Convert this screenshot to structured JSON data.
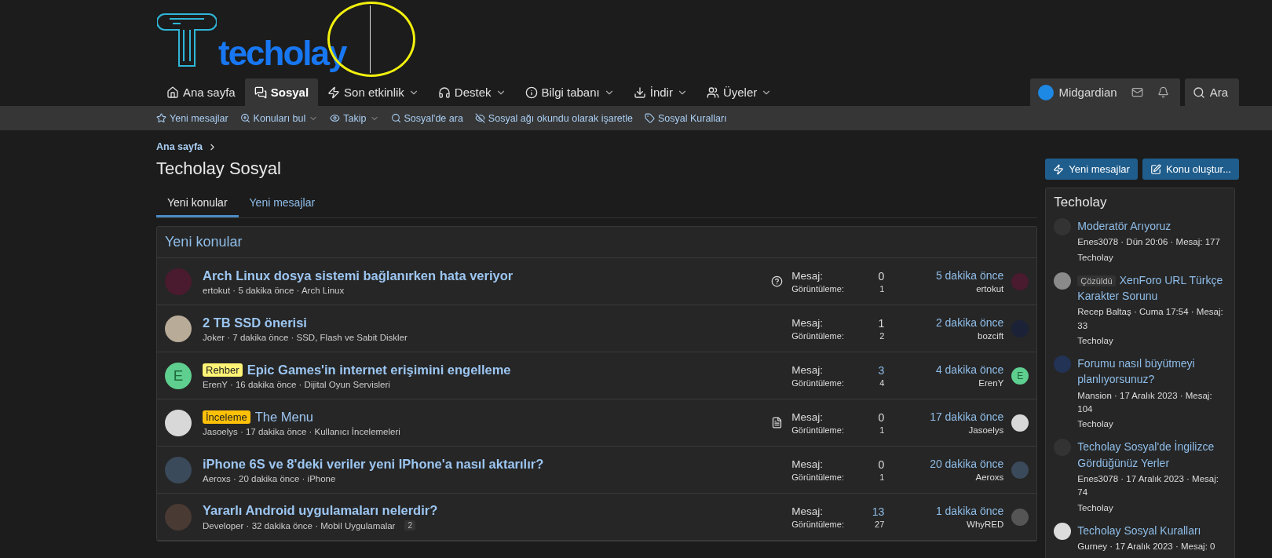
{
  "logo": {
    "text": "techolay"
  },
  "annotation": {
    "kind": "circle"
  },
  "nav": {
    "tabs": [
      {
        "label": "Ana sayfa",
        "selected": false,
        "dropdown": false
      },
      {
        "label": "Sosyal",
        "selected": true,
        "dropdown": false
      },
      {
        "label": "Son etkinlik",
        "selected": false,
        "dropdown": true
      },
      {
        "label": "Destek",
        "selected": false,
        "dropdown": true
      },
      {
        "label": "Bilgi tabanı",
        "selected": false,
        "dropdown": true
      },
      {
        "label": "İndir",
        "selected": false,
        "dropdown": true
      },
      {
        "label": "Üyeler",
        "selected": false,
        "dropdown": true
      }
    ],
    "user": {
      "name": "Midgardian"
    },
    "search": {
      "label": "Ara"
    }
  },
  "subnav": [
    {
      "label": "Yeni mesajlar",
      "dropdown": false
    },
    {
      "label": "Konuları bul",
      "dropdown": true
    },
    {
      "label": "Takip",
      "dropdown": true
    },
    {
      "label": "Sosyal'de ara",
      "dropdown": false
    },
    {
      "label": "Sosyal ağı okundu olarak işaretle",
      "dropdown": false
    },
    {
      "label": "Sosyal Kuralları",
      "dropdown": false
    }
  ],
  "breadcrumb": [
    "Ana sayfa"
  ],
  "title": "Techolay Sosyal",
  "actions": [
    "Yeni mesajlar",
    "Konu oluştur..."
  ],
  "tabs": [
    {
      "label": "Yeni konular",
      "selected": true
    },
    {
      "label": "Yeni mesajlar",
      "selected": false
    }
  ],
  "block": {
    "title": "Yeni konular",
    "rows": [
      {
        "kind": "question",
        "avatar": {
          "kind": "photo",
          "color": "#4a1a2e"
        },
        "title": "Arch Linux dosya sistemi bağlanırken hata veriyor",
        "unread": true,
        "meta": "ertokut · 5 dakika önce · Arch Linux",
        "replies_label": "Mesaj:",
        "replies": "0",
        "views_label": "Görüntüleme:",
        "views": "1",
        "last_time": "5 dakika önce",
        "last_user": "ertokut",
        "last_avatar": {
          "kind": "photo",
          "color": "#4a1a2e"
        }
      },
      {
        "kind": "plain",
        "avatar": {
          "kind": "photo",
          "color": "#b8ab98"
        },
        "title": "2 TB SSD önerisi",
        "unread": true,
        "meta": "Joker · 7 dakika önce · SSD, Flash ve Sabit Diskler",
        "replies_label": "Mesaj:",
        "replies": "1",
        "views_label": "Görüntüleme:",
        "views": "2",
        "last_time": "2 dakika önce",
        "last_user": "bozcift",
        "last_avatar": {
          "kind": "photo",
          "color": "#1b2238"
        }
      },
      {
        "kind": "plain",
        "avatar": {
          "kind": "letter",
          "letter": "E",
          "color": "#5fcf8f"
        },
        "prefix": {
          "text": "Rehber",
          "color": "#fff475"
        },
        "title": "Epic Games'in internet erişimini engelleme",
        "unread": true,
        "meta": "ErenY · 16 dakika önce · Dijital Oyun Servisleri",
        "replies_label": "Mesaj:",
        "replies": "3",
        "views_label": "Görüntüleme:",
        "views": "4",
        "last_time": "4 dakika önce",
        "last_user": "ErenY",
        "last_avatar": {
          "kind": "letter",
          "letter": "E",
          "color": "#5fcf8f"
        }
      },
      {
        "kind": "article",
        "avatar": {
          "kind": "photo",
          "color": "#d8d8d8"
        },
        "prefix": {
          "text": "İnceleme",
          "color": "#ffc107"
        },
        "title": "The Menu",
        "unread": false,
        "meta": "Jasoelys · 17 dakika önce · Kullanıcı İncelemeleri",
        "replies_label": "Mesaj:",
        "replies": "0",
        "views_label": "Görüntüleme:",
        "views": "1",
        "last_time": "17 dakika önce",
        "last_user": "Jasoelys",
        "last_avatar": {
          "kind": "photo",
          "color": "#d8d8d8"
        }
      },
      {
        "kind": "plain",
        "avatar": {
          "kind": "photo",
          "color": "#3a4a5a"
        },
        "title": "iPhone 6S ve 8'deki veriler yeni IPhone'a nasıl aktarılır?",
        "unread": true,
        "meta": "Aeroxs · 20 dakika önce · iPhone",
        "replies_label": "Mesaj:",
        "replies": "0",
        "views_label": "Görüntüleme:",
        "views": "1",
        "last_time": "20 dakika önce",
        "last_user": "Aeroxs",
        "last_avatar": {
          "kind": "photo",
          "color": "#3a4a5a"
        }
      },
      {
        "kind": "plain",
        "avatar": {
          "kind": "photo",
          "color": "#4a3a34"
        },
        "title": "Yararlı Android uygulamaları nelerdir?",
        "unread": true,
        "meta": "Developer · 32 dakika önce · Mobil Uygulamalar",
        "pages": "2",
        "replies_label": "Mesaj:",
        "replies": "13",
        "views_label": "Görüntüleme:",
        "views": "27",
        "last_time": "1 dakika önce",
        "last_user": "WhyRED",
        "last_avatar": {
          "kind": "photo",
          "color": "#555555"
        }
      }
    ]
  },
  "sidebar": {
    "title": "Techolay",
    "items": [
      {
        "title": "Moderatör Arıyoruz",
        "meta": "Enes3078 · Dün 20:06 · Mesaj: 177",
        "forum": "Techolay"
      },
      {
        "prefix": "Çözüldü",
        "title": "XenForo URL Türkçe Karakter Sorunu",
        "meta": "Recep Baltaş · Cuma 17:54 · Mesaj: 33",
        "forum": "Techolay"
      },
      {
        "title": "Forumu nasıl büyütmeyi planlıyorsunuz?",
        "meta": "Mansion · 17 Aralık 2023 · Mesaj: 104",
        "forum": "Techolay"
      },
      {
        "title": "Techolay Sosyal'de İngilizce Gördüğünüz Yerler",
        "meta": "Enes3078 · 17 Aralık 2023 · Mesaj: 74",
        "forum": "Techolay"
      },
      {
        "title": "Techolay Sosyal Kuralları",
        "meta": "Gurney · 17 Aralık 2023 · Mesaj: 0"
      }
    ]
  }
}
